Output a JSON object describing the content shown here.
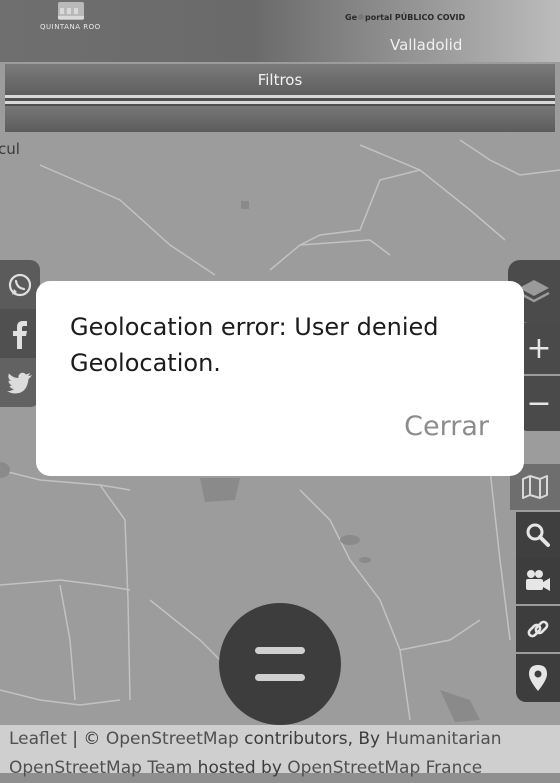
{
  "header": {
    "logo_text": "QUINTANA ROO",
    "portal_title_prefix": "Ge",
    "portal_title_suffix": "portal PÚBLICO COVID",
    "place_label": "Valladolid"
  },
  "filters": {
    "label": "Filtros"
  },
  "map": {
    "town_label": "cul"
  },
  "social": {
    "whatsapp_icon": "whatsapp-icon",
    "facebook_icon": "facebook-icon",
    "twitter_icon": "twitter-icon"
  },
  "controls": {
    "zoom_in": "+",
    "zoom_out": "−",
    "icons": [
      "layers-icon",
      "map-icon",
      "search-icon",
      "video-camera-icon",
      "link-icon",
      "location-pin-icon"
    ]
  },
  "dialog": {
    "message": "Geolocation error: User denied Geolocation.",
    "close_label": "Cerrar"
  },
  "fab": {
    "icon": "menu-icon"
  },
  "attribution": {
    "line1_leaflet": "Leaflet",
    "line1_sep": " | © ",
    "line1_osm": "OpenStreetMap",
    "line1_contrib": " contributors, By ",
    "line1_hum": "Humanitarian",
    "line2_team": "OpenStreetMap Team",
    "line2_hosted": " hosted by ",
    "line2_osmfr": "OpenStreetMap France"
  }
}
